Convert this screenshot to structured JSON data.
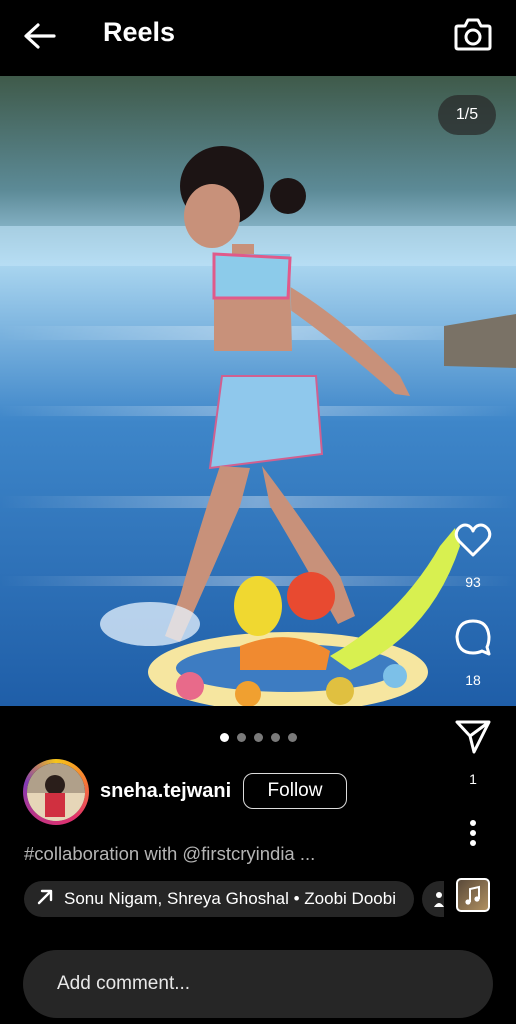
{
  "header": {
    "title": "Reels",
    "back_icon": "back-arrow-icon",
    "camera_icon": "camera-icon"
  },
  "media": {
    "counter": "1/5",
    "slide_count": 5,
    "active_slide": 1
  },
  "actions": {
    "like_count": "93",
    "comment_count": "18",
    "share_count": "1"
  },
  "user": {
    "username": "sneha.tejwani",
    "follow_label": "Follow"
  },
  "caption": {
    "hashtag": "#collaboration",
    "middle": " with ",
    "mention": "@firstcryindia",
    "ellipsis": " ..."
  },
  "music": {
    "label": "Sonu Nigam, Shreya Ghoshal • Zoobi Doobi"
  },
  "comment": {
    "placeholder": "Add comment..."
  },
  "colors": {
    "background": "#000000",
    "chip": "#262626",
    "caption_text": "#b5b5b5"
  }
}
